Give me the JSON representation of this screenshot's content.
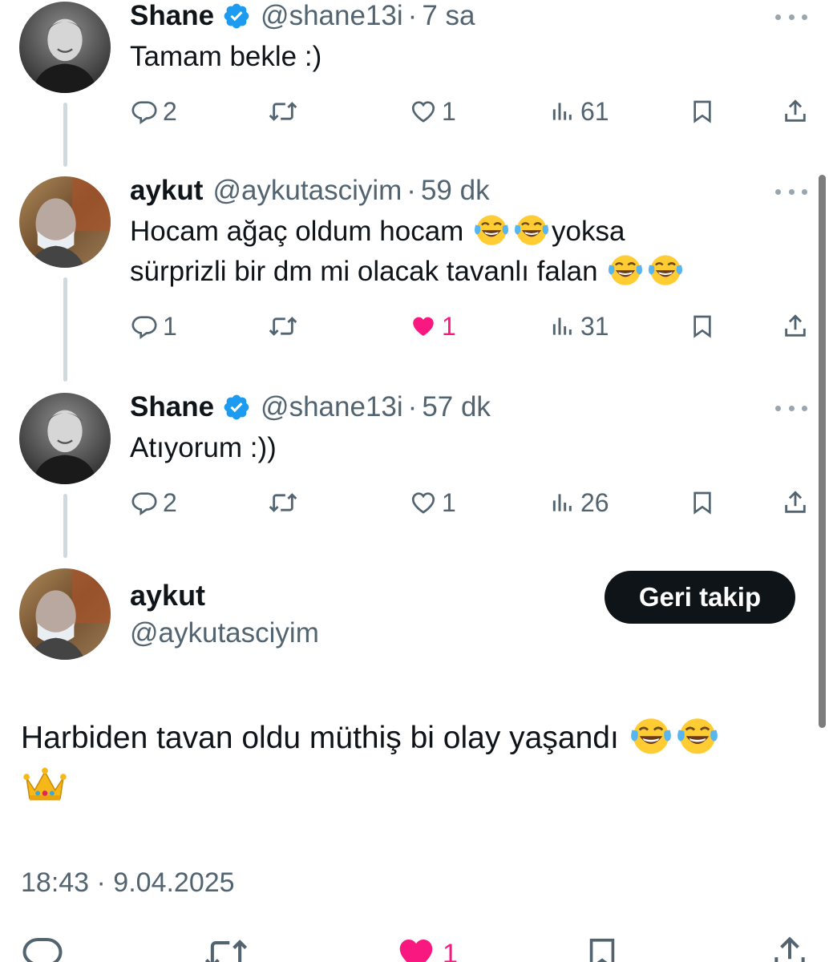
{
  "thread": [
    {
      "name": "Shane",
      "verified": true,
      "handle": "@shane13i",
      "time": "7 sa",
      "text": "Tamam bekle :)",
      "replies": "2",
      "likes": "1",
      "liked": false,
      "views": "61"
    },
    {
      "name": "aykut",
      "verified": false,
      "handle": "@aykutasciyim",
      "time": "59 dk",
      "text_line1": "Hocam ağaç oldum hocam ",
      "text_line1_tail": "yoksa",
      "text_line2": "sürprizli bir dm mi olacak tavanlı falan ",
      "replies": "1",
      "likes": "1",
      "liked": true,
      "views": "31"
    },
    {
      "name": "Shane",
      "verified": true,
      "handle": "@shane13i",
      "time": "57 dk",
      "text": "Atıyorum :))",
      "replies": "2",
      "likes": "1",
      "liked": false,
      "views": "26"
    }
  ],
  "main_tweet": {
    "name": "aykut",
    "handle": "@aykutasciyim",
    "follow_button": "Geri takip",
    "text": "Harbiden tavan oldu müthiş bi olay yaşandı ",
    "timestamp": "18:43 · 9.04.2025",
    "likes": "1",
    "liked": true
  },
  "separator": "·",
  "icons": {
    "reply": "reply-icon",
    "retweet": "retweet-icon",
    "like": "heart-icon",
    "views": "views-icon",
    "bookmark": "bookmark-icon",
    "share": "share-icon",
    "verified": "verified-badge-icon",
    "emoji_laugh": "face-with-tears-of-joy-emoji",
    "emoji_crown": "crown-emoji"
  },
  "colors": {
    "text": "#0f1419",
    "secondary": "#536471",
    "verified": "#1d9bf0",
    "like": "#f91880",
    "thread_line": "#cfd9de",
    "button_bg": "#0f1419"
  }
}
